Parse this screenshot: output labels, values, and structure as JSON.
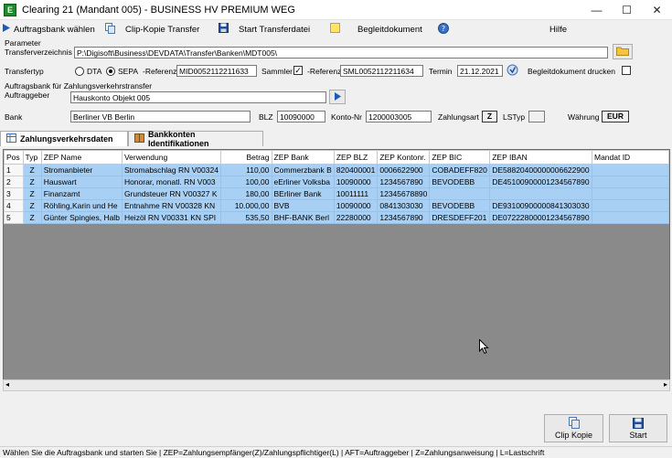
{
  "window": {
    "title": "Clearing 21 (Mandant 005) - BUSINESS HV PREMIUM WEG",
    "app_icon_letter": "E",
    "minimize": "—",
    "maximize": "☐",
    "close": "✕"
  },
  "toolbar": {
    "auftragsbank": "Auftragsbank wählen",
    "clip_kopie": "Clip-Kopie Transfer",
    "start_transfer": "Start Transferdatei",
    "begleitdokument": "Begleitdokument",
    "hilfe": "Hilfe"
  },
  "parameter": {
    "group_label": "Parameter",
    "transferverzeichnis_label": "Transferverzeichnis",
    "transferverzeichnis_value": "P:\\Digisoft\\Business\\DEVDATA\\Transfer\\Banken\\MDT005\\",
    "transfertyp_label": "Transfertyp",
    "dta_label": "DTA",
    "sepa_label": "SEPA",
    "referenz_label": "-Referenz",
    "referenz_value": "MID0052112211633",
    "sammler_label": "Sammler",
    "sammler_checked": "✓",
    "referenz2_label": "-Referenz",
    "referenz2_value": "SML0052112211634",
    "termin_label": "Termin",
    "termin_value": "21.12.2021",
    "begleitdokument_drucken_label": "Begleitdokument drucken"
  },
  "auftragsbank": {
    "group_label": "Auftragsbank für Zahlungsverkehrstransfer",
    "auftraggeber_label": "Auftraggeber",
    "auftraggeber_value": "Hauskonto Objekt 005",
    "bank_label": "Bank",
    "bank_value": "Berliner VB Berlin",
    "blz_label": "BLZ",
    "blz_value": "10090000",
    "kontonr_label": "Konto-Nr",
    "kontonr_value": "1200003005",
    "zahlungsart_label": "Zahlungsart",
    "zahlungsart_value": "Z",
    "lstyp_label": "LSTyp",
    "lstyp_value": "",
    "waehrung_label": "Währung",
    "waehrung_value": "EUR"
  },
  "tabs": [
    {
      "label": "Zahlungsverkehrsdaten",
      "active": true
    },
    {
      "label": "Bankkonten Identifikationen",
      "active": false
    }
  ],
  "table": {
    "headers": [
      "Pos",
      "Typ",
      "ZEP Name",
      "Verwendung",
      "Betrag",
      "ZEP Bank",
      "ZEP BLZ",
      "ZEP Kontonr.",
      "ZEP BIC",
      "ZEP IBAN",
      "Mandat ID"
    ],
    "rows": [
      [
        "1",
        "Z",
        "Stromanbieter",
        "Stromabschlag RN V00324",
        "110,00",
        "Commerzbank B",
        "820400001",
        "0006622900",
        "COBADEFF820",
        "DE58820400000006622900",
        ""
      ],
      [
        "2",
        "Z",
        "Hauswart",
        "Honorar, monatl. RN V003",
        "100,00",
        "eErliner Volksba",
        "10090000",
        "1234567890",
        "BEVODEBB",
        "DE45100900001234567890",
        ""
      ],
      [
        "3",
        "Z",
        "Finanzamt",
        "Grundsteuer RN V00327 K",
        "180,00",
        "BErliner Bank",
        "10011111",
        "12345678890",
        "",
        "",
        ""
      ],
      [
        "4",
        "Z",
        "Röhling,Karin und He",
        "Entnahme RN V00328 KN",
        "10.000,00",
        "BVB",
        "10090000",
        "0841303030",
        "BEVODEBB",
        "DE93100900000841303030",
        ""
      ],
      [
        "5",
        "Z",
        "Günter Spingies, Halb",
        "Heizöl RN V00331 KN SPI",
        "535,50",
        "BHF-BANK Berl",
        "22280000",
        "1234567890",
        "DRESDEFF201",
        "DE07222800001234567890",
        ""
      ]
    ]
  },
  "buttons": {
    "clip_kopie": "Clip Kopie",
    "start": "Start"
  },
  "statusbar": "Wählen Sie die Auftragsbank und starten Sie | ZEP=Zahlungsempfänger(Z)/Zahlungspflichtiger(L) | AFT=Auftraggeber | Z=Zahlungsanweisung | L=Lastschrift",
  "colors": {
    "row_selected": "#a8d0f5",
    "grid_background": "#8a8a8a",
    "app_icon": "#1f8a2c"
  }
}
